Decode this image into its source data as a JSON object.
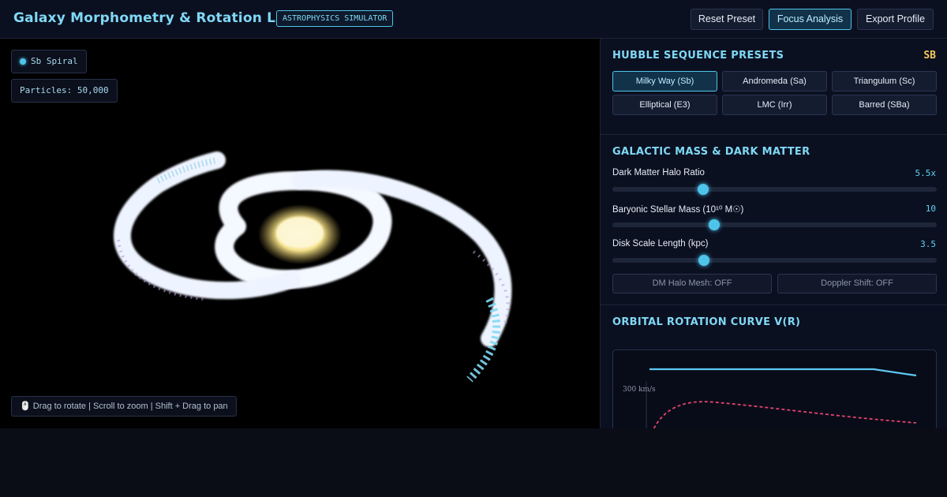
{
  "header": {
    "title": "Galaxy Morphometry & Rotation Lab",
    "badge": "ASTROPHYSICS SIMULATOR",
    "buttons": [
      "Reset Preset",
      "Focus Analysis",
      "Export Profile"
    ]
  },
  "viewport": {
    "galaxy_type": "Sb Spiral",
    "particles": "Particles: 50,000",
    "hint": "🖱️ Drag to rotate | Scroll to zoom | Shift + Drag to pan"
  },
  "presets": {
    "title": "HUBBLE SEQUENCE PRESETS",
    "current": "SB",
    "items": [
      "Milky Way (Sb)",
      "Andromeda (Sa)",
      "Triangulum (Sc)",
      "Elliptical (E3)",
      "LMC (Irr)",
      "Barred (SBa)"
    ],
    "active": "Milky Way (Sb)"
  },
  "mass": {
    "title": "GALACTIC MASS & DARK MATTER",
    "sliders": [
      {
        "label": "Dark Matter Halo Ratio",
        "value": "5.5x",
        "fraction": 0.28
      },
      {
        "label": "Baryonic Stellar Mass (10¹⁰ M☉)",
        "value": "10",
        "fraction": 0.315
      },
      {
        "label": "Disk Scale Length (kpc)",
        "value": "3.5",
        "fraction": 0.283
      }
    ],
    "toggles": [
      "DM Halo Mesh: OFF",
      "Doppler Shift: OFF"
    ]
  },
  "rotation": {
    "title": "ORBITAL ROTATION CURVE V(R)",
    "y_label": "300 km/s"
  },
  "colors": {
    "accent": "#4fc4ea",
    "preset_tag": "#f5c75a",
    "observed_curve": "#5ec8f2",
    "keplerian_curve": "#e2436e",
    "bulge": "#f3e08a"
  }
}
